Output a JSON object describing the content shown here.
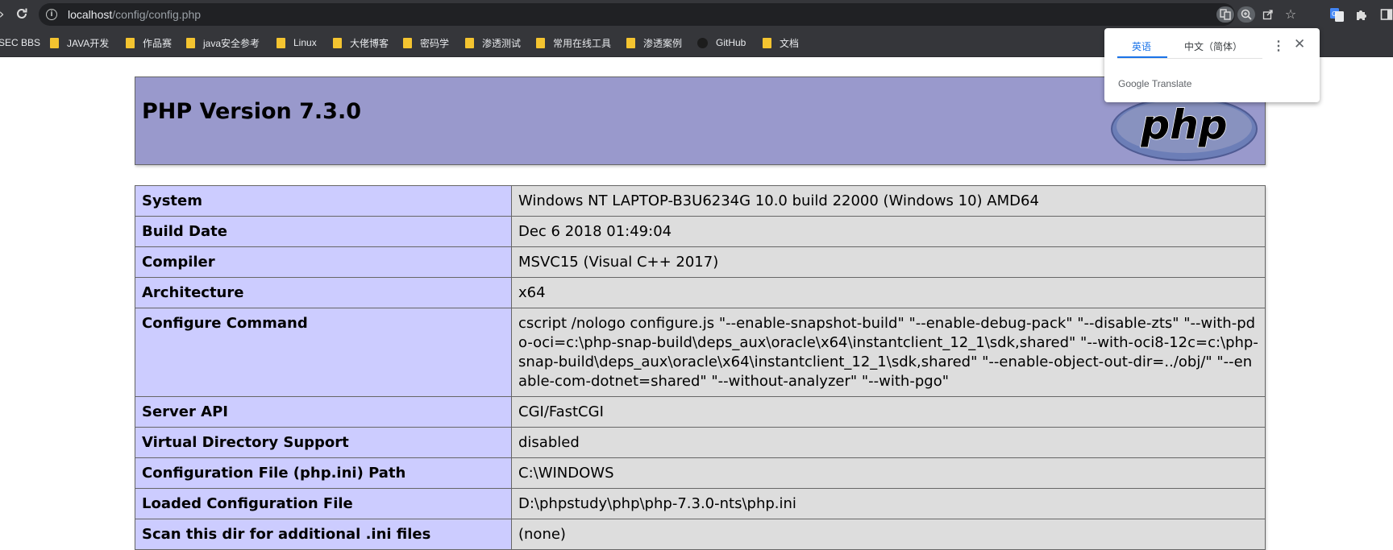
{
  "browser": {
    "url_host": "localhost",
    "url_path": "/config/config.php",
    "bookmarks": [
      {
        "label": "SEC BBS",
        "type": "plain"
      },
      {
        "label": "JAVA开发",
        "type": "folder"
      },
      {
        "label": "作品赛",
        "type": "folder"
      },
      {
        "label": "java安全参考",
        "type": "folder"
      },
      {
        "label": "Linux",
        "type": "folder"
      },
      {
        "label": "大佬博客",
        "type": "folder"
      },
      {
        "label": "密码学",
        "type": "folder"
      },
      {
        "label": "渗透测试",
        "type": "folder"
      },
      {
        "label": "常用在线工具",
        "type": "folder"
      },
      {
        "label": "渗透案例",
        "type": "folder"
      },
      {
        "label": "GitHub",
        "type": "github"
      },
      {
        "label": "文档",
        "type": "folder"
      }
    ]
  },
  "translate_popup": {
    "tab_source": "英语",
    "tab_target": "中文（简体）",
    "brand_google": "Google",
    "brand_translate": "Translate"
  },
  "phpinfo": {
    "title": "PHP Version 7.3.0",
    "logo_text": "php",
    "rows": [
      {
        "key": "System",
        "value": "Windows NT LAPTOP-B3U6234G 10.0 build 22000 (Windows 10) AMD64"
      },
      {
        "key": "Build Date",
        "value": "Dec 6 2018 01:49:04"
      },
      {
        "key": "Compiler",
        "value": "MSVC15 (Visual C++ 2017)"
      },
      {
        "key": "Architecture",
        "value": "x64"
      },
      {
        "key": "Configure Command",
        "value": "cscript /nologo configure.js \"--enable-snapshot-build\" \"--enable-debug-pack\" \"--disable-zts\" \"--with-pdo-oci=c:\\php-snap-build\\deps_aux\\oracle\\x64\\instantclient_12_1\\sdk,shared\" \"--with-oci8-12c=c:\\php-snap-build\\deps_aux\\oracle\\x64\\instantclient_12_1\\sdk,shared\" \"--enable-object-out-dir=../obj/\" \"--enable-com-dotnet=shared\" \"--without-analyzer\" \"--with-pgo\""
      },
      {
        "key": "Server API",
        "value": "CGI/FastCGI"
      },
      {
        "key": "Virtual Directory Support",
        "value": "disabled"
      },
      {
        "key": "Configuration File (php.ini) Path",
        "value": "C:\\WINDOWS"
      },
      {
        "key": "Loaded Configuration File",
        "value": "D:\\phpstudy\\php\\php-7.3.0-nts\\php.ini"
      },
      {
        "key": "Scan this dir for additional .ini files",
        "value": "(none)"
      }
    ]
  }
}
